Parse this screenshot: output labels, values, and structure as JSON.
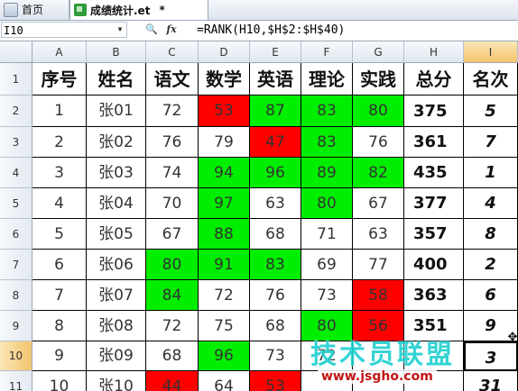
{
  "tabs": [
    {
      "label": "首页",
      "icon": "home-icon"
    },
    {
      "label": "成绩统计.et",
      "modified_marker": "*",
      "icon": "et-file-icon"
    }
  ],
  "formula_bar": {
    "cell_ref": "I10",
    "formula": "=RANK(H10,$H$2:$H$40)"
  },
  "columns": [
    "A",
    "B",
    "C",
    "D",
    "E",
    "F",
    "G",
    "H",
    "I"
  ],
  "selected_column": "I",
  "rows": [
    "1",
    "2",
    "3",
    "4",
    "5",
    "6",
    "7",
    "8",
    "9",
    "10",
    "11"
  ],
  "selected_row": "10",
  "headers": [
    "序号",
    "姓名",
    "语文",
    "数学",
    "英语",
    "理论",
    "实践",
    "总分",
    "名次"
  ],
  "records": [
    {
      "no": "1",
      "name": "张01",
      "scores": [
        "72",
        "53",
        "87",
        "83",
        "80"
      ],
      "total": "375",
      "rank": "5",
      "colors": [
        "",
        "r",
        "g",
        "g",
        "g"
      ]
    },
    {
      "no": "2",
      "name": "张02",
      "scores": [
        "76",
        "79",
        "47",
        "83",
        "76"
      ],
      "total": "361",
      "rank": "7",
      "colors": [
        "",
        "",
        "r",
        "g",
        ""
      ]
    },
    {
      "no": "3",
      "name": "张03",
      "scores": [
        "74",
        "94",
        "96",
        "89",
        "82"
      ],
      "total": "435",
      "rank": "1",
      "colors": [
        "",
        "g",
        "g",
        "g",
        "g"
      ]
    },
    {
      "no": "4",
      "name": "张04",
      "scores": [
        "70",
        "97",
        "63",
        "80",
        "67"
      ],
      "total": "377",
      "rank": "4",
      "colors": [
        "",
        "g",
        "",
        "g",
        ""
      ]
    },
    {
      "no": "5",
      "name": "张05",
      "scores": [
        "67",
        "88",
        "68",
        "71",
        "63"
      ],
      "total": "357",
      "rank": "8",
      "colors": [
        "",
        "g",
        "",
        "",
        ""
      ]
    },
    {
      "no": "6",
      "name": "张06",
      "scores": [
        "80",
        "91",
        "83",
        "69",
        "77"
      ],
      "total": "400",
      "rank": "2",
      "colors": [
        "g",
        "g",
        "g",
        "",
        ""
      ]
    },
    {
      "no": "7",
      "name": "张07",
      "scores": [
        "84",
        "72",
        "76",
        "73",
        "58"
      ],
      "total": "363",
      "rank": "6",
      "colors": [
        "g",
        "",
        "",
        "",
        "r"
      ]
    },
    {
      "no": "8",
      "name": "张08",
      "scores": [
        "72",
        "75",
        "68",
        "80",
        "56"
      ],
      "total": "351",
      "rank": "9",
      "colors": [
        "",
        "",
        "",
        "g",
        "r"
      ]
    },
    {
      "no": "9",
      "name": "张09",
      "scores": [
        "68",
        "96",
        "73",
        "72",
        "",
        "",
        ""
      ],
      "total": "",
      "rank": "3",
      "colors": [
        "",
        "g",
        "",
        "",
        ""
      ]
    },
    {
      "no": "10",
      "name": "张10",
      "scores": [
        "44",
        "64",
        "53",
        "",
        "",
        ""
      ],
      "total": "",
      "rank": "31",
      "colors": [
        "r",
        "",
        "r",
        "",
        ""
      ]
    }
  ],
  "colors": {
    "pass_high": "#00ee00",
    "fail": "#ff0000",
    "selection": "#f3c46c"
  },
  "watermark": {
    "title": "技术员联盟",
    "url": "www.jsgho.com"
  }
}
